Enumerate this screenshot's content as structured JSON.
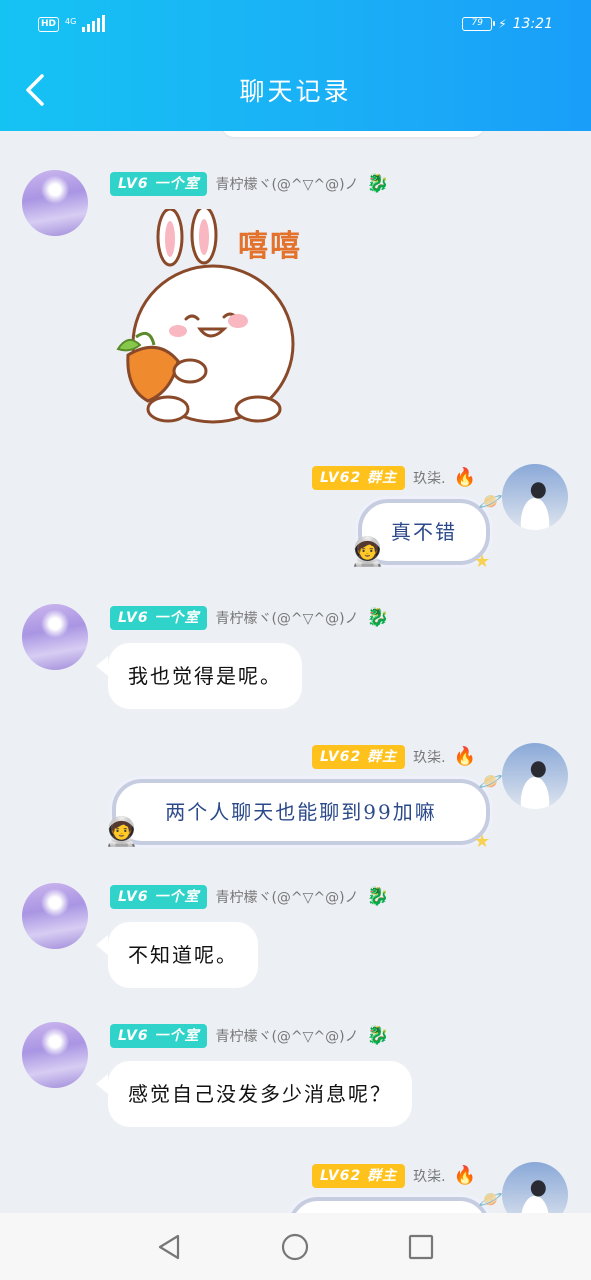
{
  "status_bar": {
    "hd": "HD",
    "network": "4G",
    "battery": "79",
    "time": "13:21"
  },
  "header": {
    "title": "聊天记录",
    "back_icon": "chevron-left-icon"
  },
  "messages": [
    {
      "side": "left",
      "level": "LV6",
      "title": "一个室",
      "nickname": "青柠檬ヾ(@^▽^@)ノ",
      "deco_icon": "dragon-icon",
      "type": "sticker",
      "sticker_text": "嘻嘻"
    },
    {
      "side": "right",
      "level": "LV62",
      "title": "群主",
      "nickname": "玖柒.",
      "deco_icon": "fire-icon",
      "type": "fancy",
      "text": "真不错"
    },
    {
      "side": "left",
      "level": "LV6",
      "title": "一个室",
      "nickname": "青柠檬ヾ(@^▽^@)ノ",
      "deco_icon": "dragon-icon",
      "type": "text",
      "text": "我也觉得是呢。"
    },
    {
      "side": "right",
      "level": "LV62",
      "title": "群主",
      "nickname": "玖柒.",
      "deco_icon": "fire-icon",
      "type": "fancy",
      "text": "两个人聊天也能聊到99加嘛"
    },
    {
      "side": "left",
      "level": "LV6",
      "title": "一个室",
      "nickname": "青柠檬ヾ(@^▽^@)ノ",
      "deco_icon": "dragon-icon",
      "type": "text",
      "text": "不知道呢。"
    },
    {
      "side": "left",
      "level": "LV6",
      "title": "一个室",
      "nickname": "青柠檬ヾ(@^▽^@)ノ",
      "deco_icon": "dragon-icon",
      "type": "text",
      "text": "感觉自己没发多少消息呢？"
    },
    {
      "side": "right",
      "level": "LV62",
      "title": "群主",
      "nickname": "玖柒.",
      "deco_icon": "fire-icon",
      "type": "fancy",
      "text": ""
    }
  ],
  "nav_bar": {
    "back": "back-triangle-icon",
    "home": "home-circle-icon",
    "recents": "recents-square-icon"
  },
  "colors": {
    "header_start": "#15c3f3",
    "header_end": "#199ef9",
    "level_teal": "#2fd3c9",
    "level_gold": "#ffc21c",
    "chat_bg": "#eceff4"
  }
}
